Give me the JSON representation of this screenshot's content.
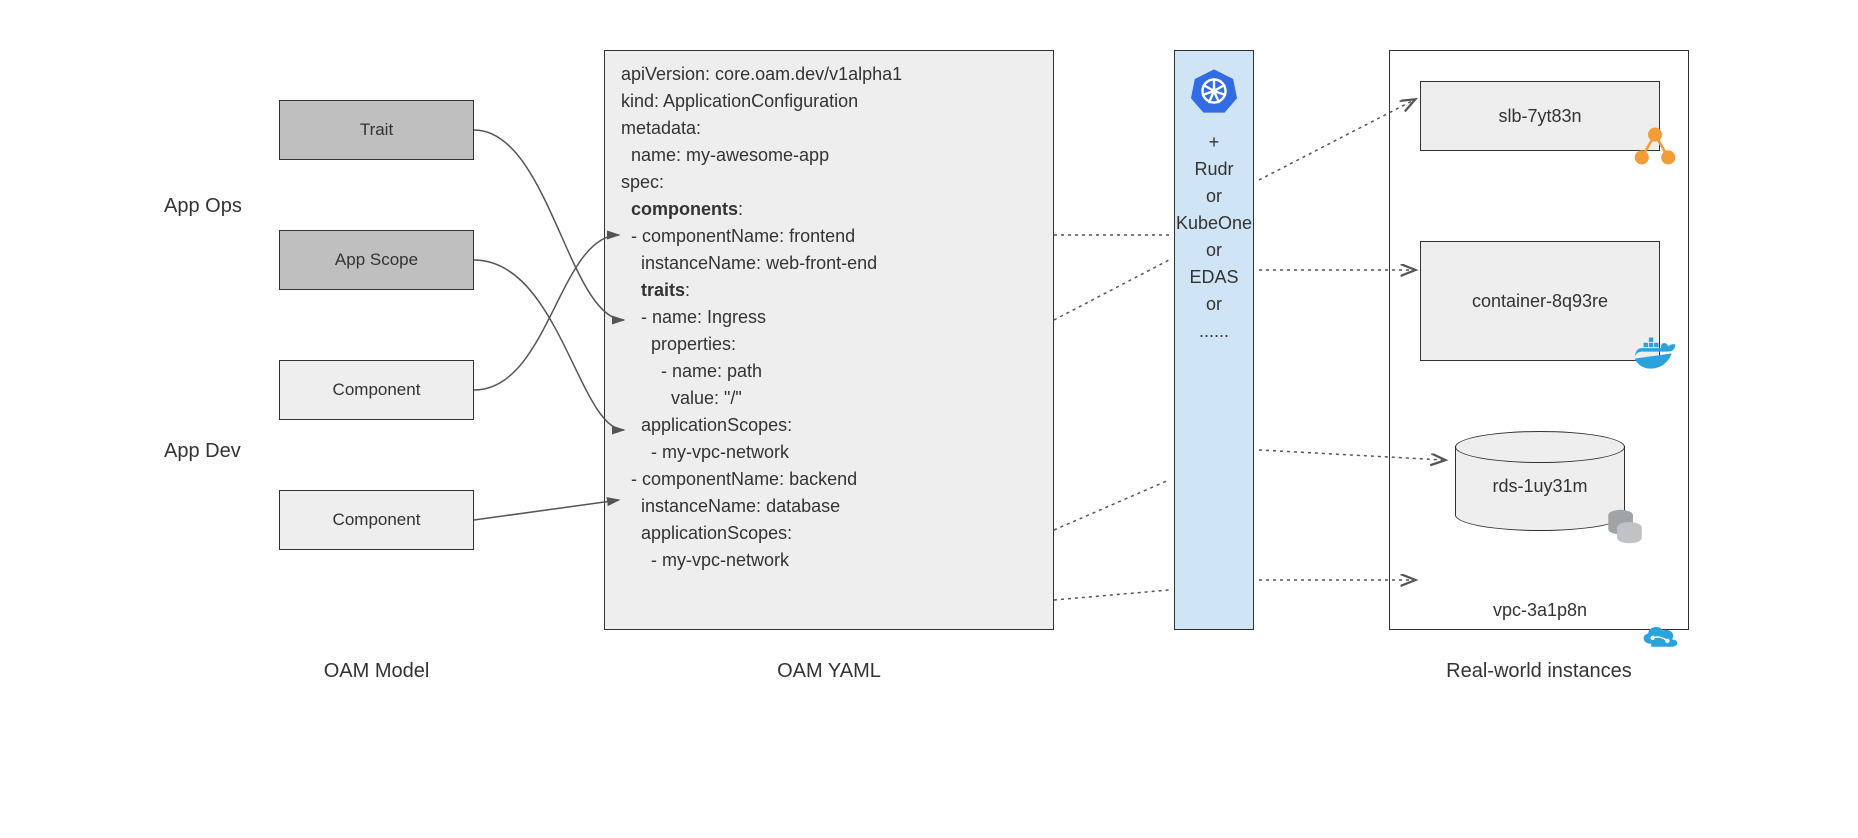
{
  "roles": {
    "ops": "App Ops",
    "dev": "App Dev"
  },
  "model": {
    "trait": "Trait",
    "appScope": "App Scope",
    "component1": "Component",
    "component2": "Component",
    "section": "OAM Model"
  },
  "yaml": {
    "l1": "apiVersion: core.oam.dev/v1alpha1",
    "l2": "kind: ApplicationConfiguration",
    "l3": "metadata:",
    "l4": "  name: my-awesome-app",
    "l5": "spec:",
    "l6": "  components",
    "l6s": ":",
    "l7": "  - componentName: frontend",
    "l8": "    instanceName: web-front-end",
    "l9": "    traits",
    "l9s": ":",
    "l10": "    - name: Ingress",
    "l11": "      properties:",
    "l12": "        - name: path",
    "l13": "          value: \"/\"",
    "l14": "    applicationScopes:",
    "l15": "      - my-vpc-network",
    "l16": "  - componentName: backend",
    "l17": "    instanceName: database",
    "l18": "    applicationScopes:",
    "l19": "      - my-vpc-network",
    "section": "OAM YAML"
  },
  "runtime": {
    "plus": "+",
    "r1": "Rudr",
    "or": "or",
    "r2": "KubeOne",
    "r3": "EDAS",
    "dots": "......"
  },
  "instances": {
    "slb": "slb-7yt83n",
    "container": "container-8q93re",
    "rds": "rds-1uy31m",
    "vpc": "vpc-3a1p8n",
    "section": "Real-world instances"
  },
  "icons": {
    "k8s": "kubernetes-icon",
    "slb": "load-balancer-icon",
    "docker": "docker-icon",
    "db": "database-icon",
    "cloud": "cloud-icon"
  }
}
